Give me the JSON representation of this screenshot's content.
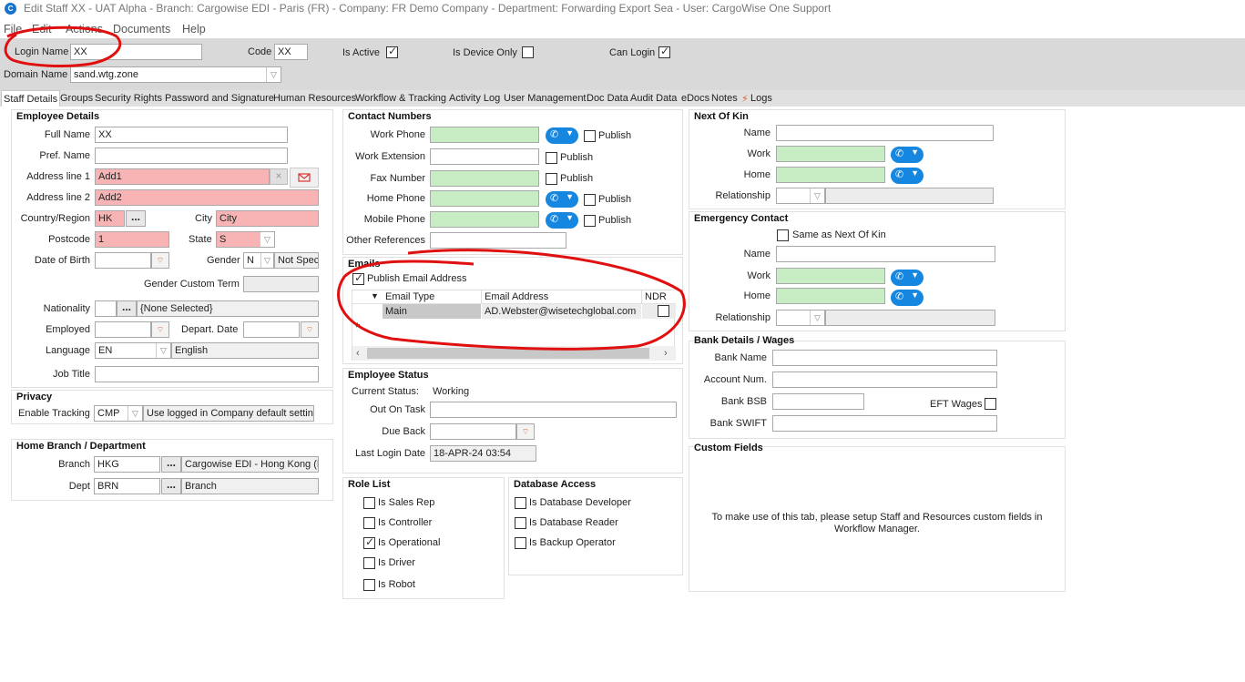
{
  "window": {
    "title": "Edit Staff XX - UAT Alpha - Branch: Cargowise EDI - Paris (FR) - Company: FR Demo Company - Department: Forwarding Export Sea - User: CargoWise One Support",
    "logo_letter": "C"
  },
  "menu": [
    "File",
    "Edit",
    "Actions",
    "Documents",
    "Help"
  ],
  "header": {
    "login_name_label": "Login Name",
    "login_name_value": "XX",
    "code_label": "Code",
    "code_value": "XX",
    "is_active_label": "Is Active",
    "is_device_only_label": "Is Device Only",
    "can_login_label": "Can Login",
    "domain_name_label": "Domain Name",
    "domain_name_value": "sand.wtg.zone"
  },
  "tabs": [
    "Staff Details",
    "Groups",
    "Security Rights",
    "Password and Signature",
    "Human Resources",
    "Workflow & Tracking",
    "Activity Log",
    "User Management",
    "Doc Data",
    "Audit Data",
    "eDocs",
    "Notes",
    "Logs"
  ],
  "employee": {
    "title": "Employee Details",
    "full_name_label": "Full Name",
    "full_name": "XX",
    "pref_name_label": "Pref. Name",
    "pref_name": "",
    "address1_label": "Address line 1",
    "address1": "Add1",
    "address2_label": "Address line 2",
    "address2": "Add2",
    "country_label": "Country/Region",
    "country": "HK",
    "city_label": "City",
    "city": "City",
    "postcode_label": "Postcode",
    "postcode": "1",
    "state_label": "State",
    "state": "S",
    "dob_label": "Date of Birth",
    "gender_label": "Gender",
    "gender": "N",
    "gender_text": "Not Speci",
    "gender_custom_label": "Gender Custom Term",
    "nationality_label": "Nationality",
    "nationality_text": "{None Selected}",
    "employed_label": "Employed",
    "depart_label": "Depart. Date",
    "language_label": "Language",
    "language": "EN",
    "language_text": "English",
    "job_title_label": "Job Title"
  },
  "privacy": {
    "title": "Privacy",
    "tracking_label": "Enable Tracking",
    "tracking": "CMP",
    "tracking_text": "Use logged in Company default setting"
  },
  "home_branch": {
    "title": "Home Branch / Department",
    "branch_label": "Branch",
    "branch": "HKG",
    "branch_text": "Cargowise EDI - Hong Kong (HI",
    "dept_label": "Dept",
    "dept": "BRN",
    "dept_text": "Branch"
  },
  "contact": {
    "title": "Contact Numbers",
    "work_label": "Work Phone",
    "work_ext_label": "Work Extension",
    "fax_label": "Fax Number",
    "home_label": "Home Phone",
    "mobile_label": "Mobile Phone",
    "other_label": "Other References",
    "publish_label": "Publish"
  },
  "emails": {
    "title": "Emails",
    "publish_label": "Publish Email Address",
    "col_type": "Email Type",
    "col_address": "Email Address",
    "col_ndr": "NDR",
    "rows": [
      {
        "type": "Main",
        "address": "AD.Webster@wisetechglobal.com"
      }
    ],
    "new_row_marker": "*"
  },
  "status": {
    "title": "Employee Status",
    "current_label": "Current Status:",
    "current": "Working",
    "out_label": "Out On Task",
    "due_label": "Due Back",
    "last_login_label": "Last Login Date",
    "last_login": "18-APR-24 03:54"
  },
  "roles": {
    "title": "Role List",
    "items": [
      {
        "label": "Is Sales Rep",
        "checked": false
      },
      {
        "label": "Is Controller",
        "checked": false
      },
      {
        "label": "Is Operational",
        "checked": true
      },
      {
        "label": "Is Driver",
        "checked": false
      },
      {
        "label": "Is Robot",
        "checked": false
      }
    ]
  },
  "db_access": {
    "title": "Database Access",
    "items": [
      {
        "label": "Is Database Developer",
        "checked": false
      },
      {
        "label": "Is Database Reader",
        "checked": false
      },
      {
        "label": "Is Backup Operator",
        "checked": false
      }
    ]
  },
  "next_of_kin": {
    "title": "Next Of Kin",
    "name_label": "Name",
    "work_label": "Work",
    "home_label": "Home",
    "relationship_label": "Relationship"
  },
  "emergency": {
    "title": "Emergency Contact",
    "same_label": "Same as Next Of Kin",
    "name_label": "Name",
    "work_label": "Work",
    "home_label": "Home",
    "relationship_label": "Relationship"
  },
  "bank": {
    "title": "Bank Details / Wages",
    "name_label": "Bank Name",
    "account_label": "Account Num.",
    "bsb_label": "Bank BSB",
    "eft_label": "EFT Wages",
    "swift_label": "Bank SWIFT"
  },
  "custom": {
    "title": "Custom Fields",
    "message_line1": "To make use of this tab, please setup Staff and Resources custom fields in",
    "message_line2": "Workflow Manager."
  },
  "icons": {
    "phone": "phone-icon",
    "date": "calendar-icon",
    "mail": "mail-icon",
    "clear": "clear-icon"
  },
  "colors": {
    "required": "#f8b4b4",
    "phone_field": "#c8ecc4",
    "phone_button": "#1687e0",
    "annotation": "#e01010"
  }
}
